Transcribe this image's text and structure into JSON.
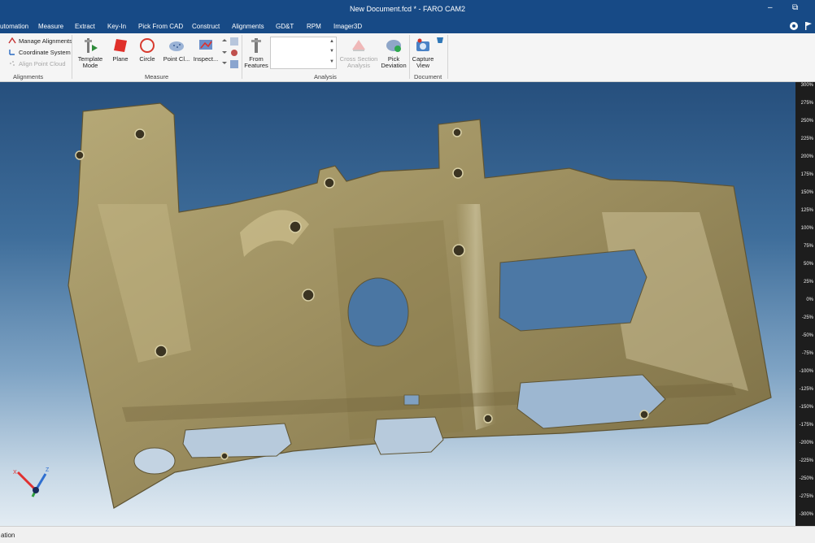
{
  "window": {
    "title": "New Document.fcd * - FARO CAM2",
    "minimize_glyph": "–",
    "restore_glyph": "⧉"
  },
  "menu": {
    "tabs": [
      "utomation",
      "Measure",
      "Extract",
      "Key-In",
      "Pick From CAD",
      "Construct",
      "Alignments",
      "GD&T",
      "RPM",
      "Imager3D"
    ],
    "right_icons": [
      "settings-gear-icon",
      "flag-icon"
    ]
  },
  "ribbon": {
    "alignments": {
      "items": [
        "Manage Alignments",
        "Coordinate System",
        "Align Point Cloud"
      ],
      "label": "Alignments"
    },
    "measure": {
      "buttons": [
        {
          "label_line1": "Template",
          "label_line2": "Mode",
          "icon": "template-mode-icon"
        },
        {
          "label_line1": "Plane",
          "label_line2": "",
          "icon": "plane-icon"
        },
        {
          "label_line1": "Circle",
          "label_line2": "",
          "icon": "circle-icon"
        },
        {
          "label_line1": "Point Cl...",
          "label_line2": "",
          "icon": "point-cloud-icon"
        },
        {
          "label_line1": "Inspect...",
          "label_line2": "",
          "icon": "inspect-icon"
        }
      ],
      "label": "Measure"
    },
    "analysis": {
      "from_features_line1": "From",
      "from_features_line2": "Features",
      "cross_section_line1": "Cross Section",
      "cross_section_line2": "Analysis",
      "pick_deviation_line1": "Pick",
      "pick_deviation_line2": "Deviation",
      "label": "Analysis"
    },
    "document": {
      "capture_line1": "Capture",
      "capture_line2": "View",
      "label": "Document"
    }
  },
  "triad": {
    "x": "X",
    "z": "Z"
  },
  "colorbar": {
    "labels": [
      "300%",
      "275%",
      "250%",
      "225%",
      "200%",
      "175%",
      "150%",
      "125%",
      "100%",
      "75%",
      "50%",
      "25%",
      "0%",
      "-25%",
      "-50%",
      "-75%",
      "-100%",
      "-125%",
      "-150%",
      "-175%",
      "-200%",
      "-225%",
      "-250%",
      "-275%",
      "-300%"
    ]
  },
  "status": {
    "text": "ation"
  },
  "colors": {
    "brand_blue": "#174a86",
    "part_gold": "#9e9165",
    "ribbon_bg": "#f5f5f5"
  }
}
